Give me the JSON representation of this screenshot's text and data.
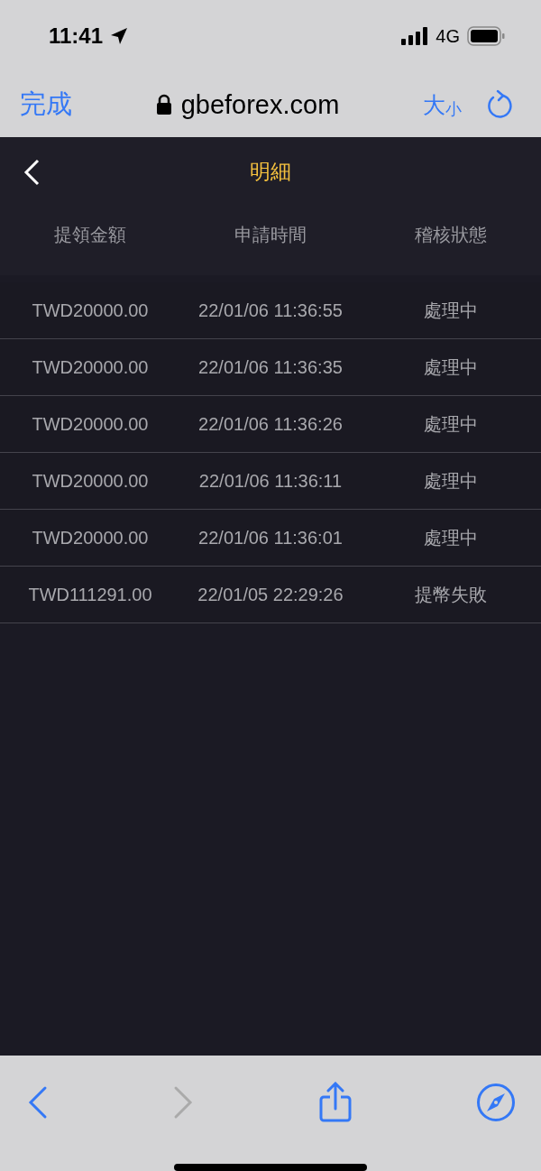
{
  "status_bar": {
    "time": "11:41",
    "network": "4G"
  },
  "browser": {
    "done": "完成",
    "url": "gbeforex.com",
    "text_size": [
      "大",
      "小"
    ]
  },
  "header": {
    "title": "明細"
  },
  "table": {
    "columns": [
      "提領金額",
      "申請時間",
      "稽核狀態"
    ],
    "rows": [
      [
        "TWD20000.00",
        "22/01/06 11:36:55",
        "處理中"
      ],
      [
        "TWD20000.00",
        "22/01/06 11:36:35",
        "處理中"
      ],
      [
        "TWD20000.00",
        "22/01/06 11:36:26",
        "處理中"
      ],
      [
        "TWD20000.00",
        "22/01/06 11:36:11",
        "處理中"
      ],
      [
        "TWD20000.00",
        "22/01/06 11:36:01",
        "處理中"
      ],
      [
        "TWD111291.00",
        "22/01/05 22:29:26",
        "提幣失敗"
      ]
    ]
  },
  "toolbar": {
    "back_disabled": false,
    "forward_disabled": true
  }
}
